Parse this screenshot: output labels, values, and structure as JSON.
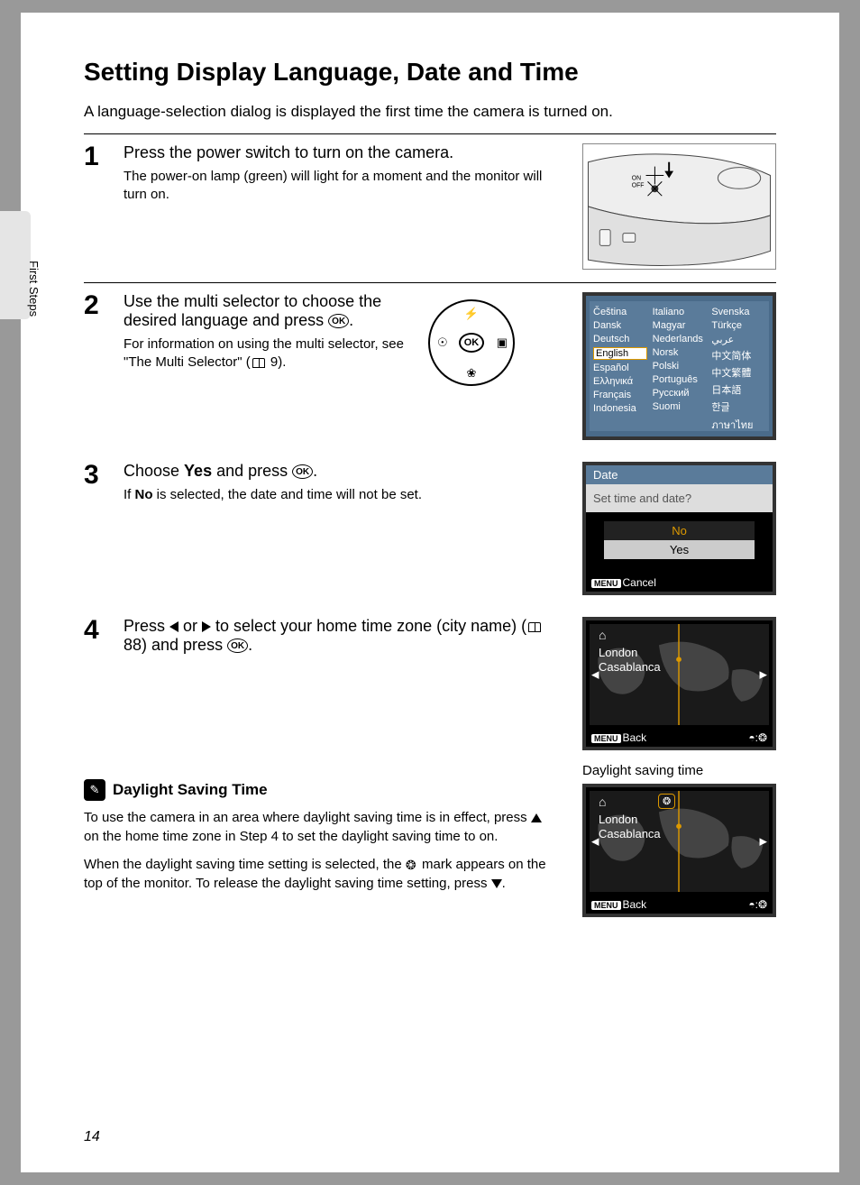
{
  "sideLabel": "First Steps",
  "title": "Setting Display Language, Date and Time",
  "intro": "A language-selection dialog is displayed the first time the camera is turned on.",
  "steps": {
    "s1": {
      "num": "1",
      "title": "Press the power switch to turn on the camera.",
      "detail": "The power-on lamp (green) will light for a moment and the monitor will turn on."
    },
    "s2": {
      "num": "2",
      "title_a": "Use the multi selector to choose the desired language and press ",
      "title_b": ".",
      "detail_a": "For information on using the multi selector, see \"The Multi Selector\" (",
      "detail_b": " 9).",
      "ok": "OK"
    },
    "s3": {
      "num": "3",
      "title_a": "Choose ",
      "title_b": "Yes",
      "title_c": " and press ",
      "title_d": ".",
      "detail_a": "If ",
      "detail_b": "No",
      "detail_c": " is selected, the date and time will not be set."
    },
    "s4": {
      "num": "4",
      "title_a": "Press ",
      "title_b": " or ",
      "title_c": " to select your home time zone (city name) (",
      "title_d": " 88) and press ",
      "title_e": "."
    }
  },
  "langScreen": {
    "c1": [
      "Čeština",
      "Dansk",
      "Deutsch",
      "English",
      "Español",
      "Ελληνικά",
      "Français",
      "Indonesia"
    ],
    "c2": [
      "Italiano",
      "Magyar",
      "Nederlands",
      "Norsk",
      "Polski",
      "Português",
      "Русский",
      "Suomi"
    ],
    "c3": [
      "Svenska",
      "Türkçe",
      "عربي",
      "中文简体",
      "中文繁體",
      "日本語",
      "한글",
      "ภาษาไทย"
    ]
  },
  "dateScreen": {
    "hdr": "Date",
    "q": "Set time and date?",
    "no": "No",
    "yes": "Yes",
    "menu": "MENU",
    "cancel": "Cancel"
  },
  "mapScreen": {
    "loc1": "London",
    "loc2": "Casablanca",
    "menu": "MENU",
    "back": "Back",
    "home": "⌂"
  },
  "dst": {
    "title": "Daylight Saving Time",
    "p1_a": "To use the camera in an area where daylight saving time is in effect, press ",
    "p1_b": " on the home time zone in Step 4 to set the daylight saving time to on.",
    "p2_a": "When the daylight saving time setting is selected, the ",
    "p2_b": " mark appears on the top of the monitor. To release the daylight saving time setting, press ",
    "p2_c": ".",
    "caption": "Daylight saving time"
  },
  "pageNumber": "14",
  "okLabel": "OK"
}
